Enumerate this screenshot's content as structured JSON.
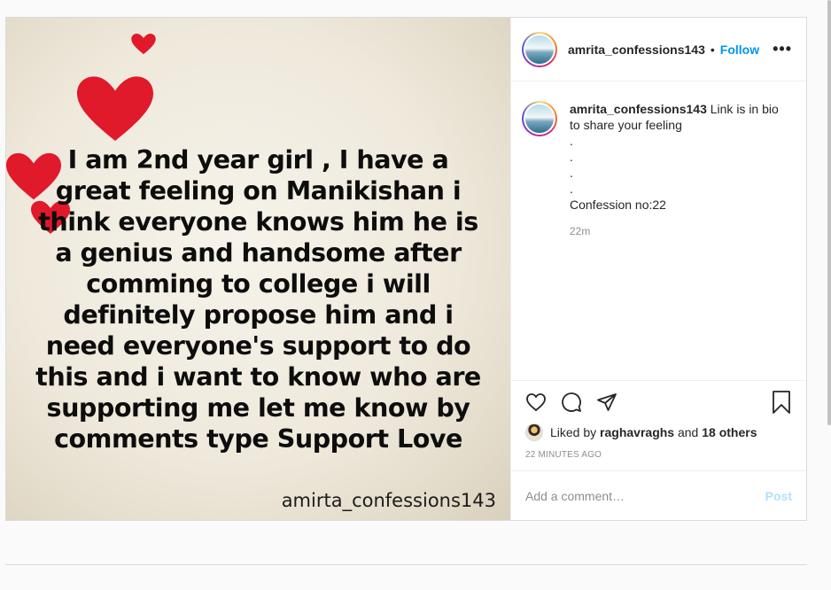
{
  "post": {
    "username": "amrita_confessions143",
    "separator": "•",
    "follow_label": "Follow",
    "more_label": "•••",
    "image_text": "I am 2nd year girl , I have a great feeling on Manikishan i think everyone knows him he is a genius and handsome after comming to college i will definitely propose him and i need everyone's support to do this and i want to know who are supporting me let me know by comments  type Support Love",
    "image_watermark": "amirta_confessions143",
    "caption": {
      "username": "amrita_confessions143",
      "text": "Link is in bio to share your feeling",
      "dots": [
        ".",
        ".",
        ".",
        "."
      ],
      "confession": "Confession no:22",
      "time": "22m"
    },
    "likes": {
      "prefix": "Liked by",
      "user": "raghavraghs",
      "and": "and",
      "others": "18 others"
    },
    "posted_ago": "22 MINUTES AGO",
    "comment_placeholder": "Add a comment…",
    "post_label": "Post"
  },
  "icons": {
    "like": "heart-icon",
    "comment": "comment-icon",
    "share": "share-icon",
    "save": "bookmark-icon",
    "more": "more-options-icon"
  },
  "colors": {
    "accent": "#0095f6",
    "post_disabled": "#b2dffc",
    "heart_red": "#e0192b"
  }
}
